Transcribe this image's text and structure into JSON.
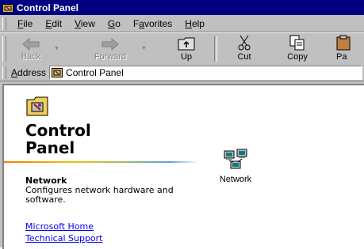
{
  "window": {
    "title": "Control Panel"
  },
  "menu": [
    {
      "label": "File",
      "key": "F",
      "rest": "ile"
    },
    {
      "label": "Edit",
      "key": "E",
      "rest": "dit"
    },
    {
      "label": "View",
      "key": "V",
      "rest": "iew"
    },
    {
      "label": "Go",
      "key": "G",
      "rest": "o"
    },
    {
      "label": "Favorites",
      "pre": "F",
      "key": "a",
      "rest": "vorites"
    },
    {
      "label": "Help",
      "key": "H",
      "rest": "elp"
    }
  ],
  "toolbar": {
    "back": "Back",
    "forward": "Forward",
    "up": "Up",
    "cut": "Cut",
    "copy": "Copy",
    "paste": "Pa"
  },
  "address": {
    "label_key": "A",
    "label_rest": "ddress",
    "value": "Control Panel"
  },
  "left_pane": {
    "title_line1": "Control",
    "title_line2": "Panel",
    "selected_name": "Network",
    "selected_desc": "Configures network hardware and software.",
    "links": [
      "Microsoft Home",
      "Technical Support"
    ]
  },
  "items": [
    {
      "label": "Network",
      "icon": "network-icon"
    }
  ],
  "colors": {
    "titlebar": "#000080",
    "link": "#0000ee",
    "face": "#c0c0c0"
  }
}
